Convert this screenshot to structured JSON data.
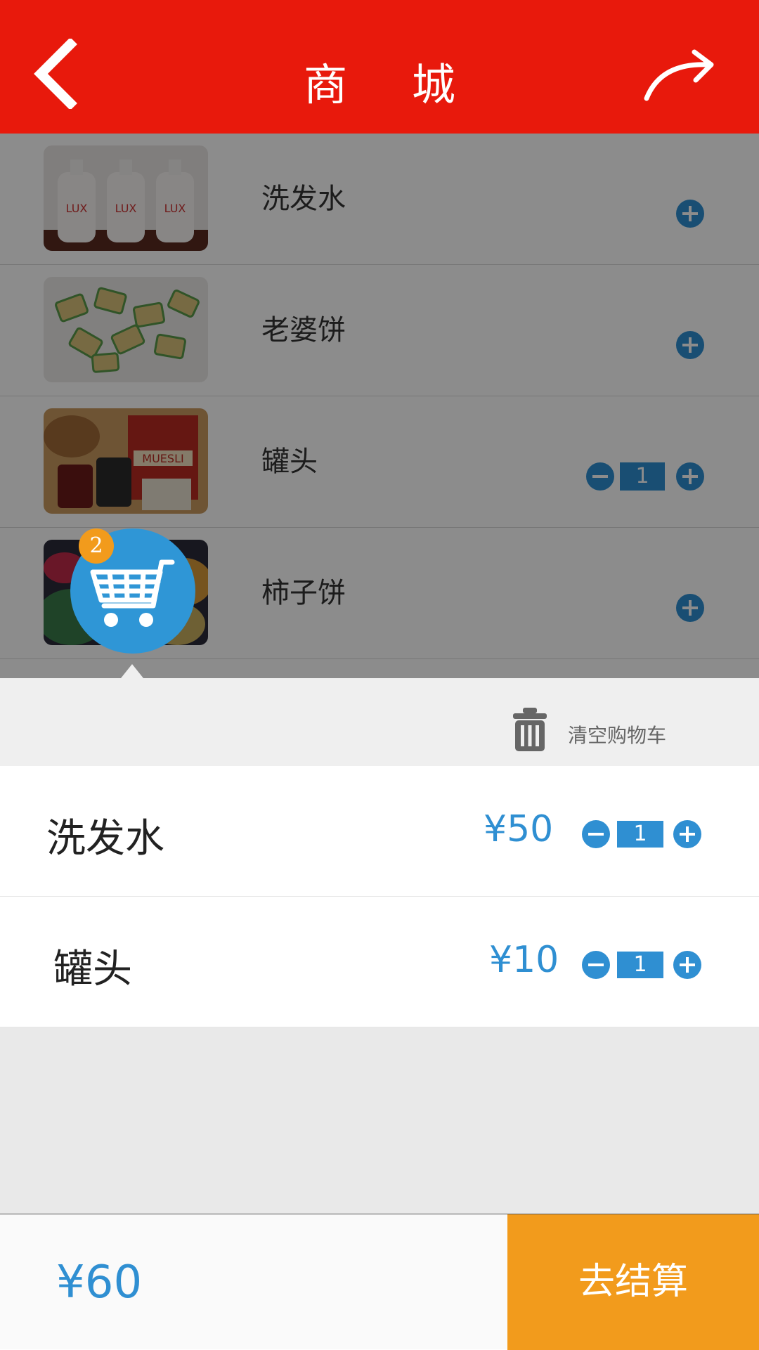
{
  "header": {
    "title": "商 城",
    "back_icon": "chevron-left-icon",
    "share_icon": "share-arrow-icon",
    "background": "#e8190c"
  },
  "products": [
    {
      "name": "洗发水",
      "thumb": "shampoo-image",
      "quantity": null
    },
    {
      "name": "老婆饼",
      "thumb": "pastry-image",
      "quantity": null
    },
    {
      "name": "罐头",
      "thumb": "canned-goods-image",
      "quantity": "1"
    },
    {
      "name": "柿子饼",
      "thumb": "persimmon-cake-image",
      "quantity": null
    }
  ],
  "cart_fab": {
    "icon": "shopping-cart-icon",
    "badge_count": "2"
  },
  "cart_panel": {
    "clear_label": "清空购物车",
    "clear_icon": "trash-icon",
    "items": [
      {
        "name": "洗发水",
        "price": "¥50",
        "quantity": "1"
      },
      {
        "name": "罐头",
        "price": "¥10",
        "quantity": "1"
      }
    ]
  },
  "footer": {
    "total": "¥60",
    "checkout_label": "去结算"
  },
  "colors": {
    "accent_blue": "#2f8fd2",
    "accent_orange": "#f29b1c"
  }
}
